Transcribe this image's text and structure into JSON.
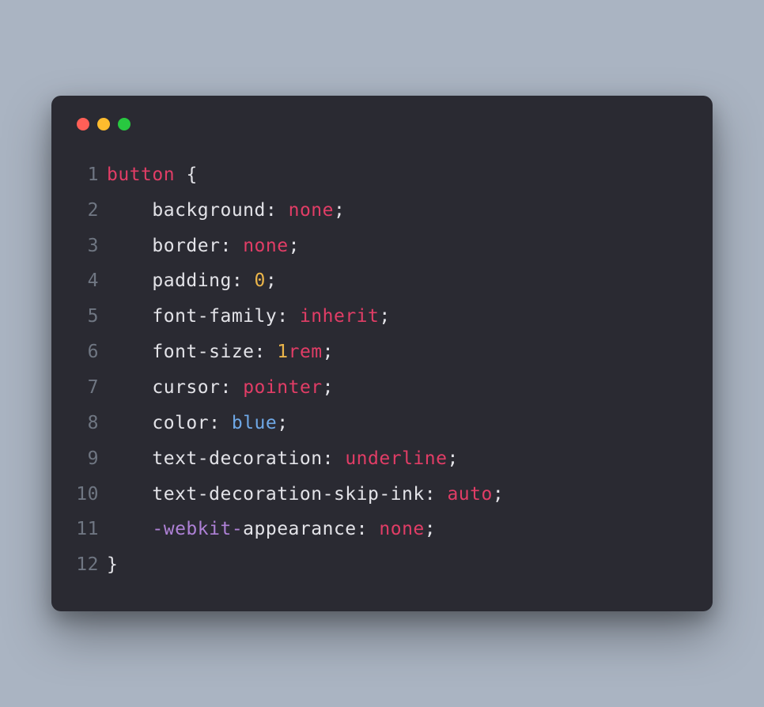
{
  "code": {
    "lines": [
      {
        "n": "1",
        "tokens": [
          {
            "t": "button",
            "c": "tok-selector"
          },
          {
            "t": " ",
            "c": "tok-default"
          },
          {
            "t": "{",
            "c": "tok-brace"
          }
        ]
      },
      {
        "n": "2",
        "tokens": [
          {
            "t": "    background",
            "c": "tok-default"
          },
          {
            "t": ":",
            "c": "tok-punct"
          },
          {
            "t": " ",
            "c": "tok-default"
          },
          {
            "t": "none",
            "c": "tok-value-keyword"
          },
          {
            "t": ";",
            "c": "tok-punct"
          }
        ]
      },
      {
        "n": "3",
        "tokens": [
          {
            "t": "    border",
            "c": "tok-default"
          },
          {
            "t": ":",
            "c": "tok-punct"
          },
          {
            "t": " ",
            "c": "tok-default"
          },
          {
            "t": "none",
            "c": "tok-value-keyword"
          },
          {
            "t": ";",
            "c": "tok-punct"
          }
        ]
      },
      {
        "n": "4",
        "tokens": [
          {
            "t": "    padding",
            "c": "tok-default"
          },
          {
            "t": ":",
            "c": "tok-punct"
          },
          {
            "t": " ",
            "c": "tok-default"
          },
          {
            "t": "0",
            "c": "tok-number"
          },
          {
            "t": ";",
            "c": "tok-punct"
          }
        ]
      },
      {
        "n": "5",
        "tokens": [
          {
            "t": "    font-family",
            "c": "tok-default"
          },
          {
            "t": ":",
            "c": "tok-punct"
          },
          {
            "t": " ",
            "c": "tok-default"
          },
          {
            "t": "inherit",
            "c": "tok-value-keyword"
          },
          {
            "t": ";",
            "c": "tok-punct"
          }
        ]
      },
      {
        "n": "6",
        "tokens": [
          {
            "t": "    font-size",
            "c": "tok-default"
          },
          {
            "t": ":",
            "c": "tok-punct"
          },
          {
            "t": " ",
            "c": "tok-default"
          },
          {
            "t": "1",
            "c": "tok-number"
          },
          {
            "t": "rem",
            "c": "tok-unit"
          },
          {
            "t": ";",
            "c": "tok-punct"
          }
        ]
      },
      {
        "n": "7",
        "tokens": [
          {
            "t": "    cursor",
            "c": "tok-default"
          },
          {
            "t": ":",
            "c": "tok-punct"
          },
          {
            "t": " ",
            "c": "tok-default"
          },
          {
            "t": "pointer",
            "c": "tok-value-keyword"
          },
          {
            "t": ";",
            "c": "tok-punct"
          }
        ]
      },
      {
        "n": "8",
        "tokens": [
          {
            "t": "    color",
            "c": "tok-default"
          },
          {
            "t": ":",
            "c": "tok-punct"
          },
          {
            "t": " ",
            "c": "tok-default"
          },
          {
            "t": "blue",
            "c": "tok-color"
          },
          {
            "t": ";",
            "c": "tok-punct"
          }
        ]
      },
      {
        "n": "9",
        "tokens": [
          {
            "t": "    text-decoration",
            "c": "tok-default"
          },
          {
            "t": ":",
            "c": "tok-punct"
          },
          {
            "t": " ",
            "c": "tok-default"
          },
          {
            "t": "underline",
            "c": "tok-value-keyword"
          },
          {
            "t": ";",
            "c": "tok-punct"
          }
        ]
      },
      {
        "n": "10",
        "tokens": [
          {
            "t": "    text-decoration-skip-ink",
            "c": "tok-default"
          },
          {
            "t": ":",
            "c": "tok-punct"
          },
          {
            "t": " ",
            "c": "tok-default"
          },
          {
            "t": "auto",
            "c": "tok-value-keyword"
          },
          {
            "t": ";",
            "c": "tok-punct"
          }
        ]
      },
      {
        "n": "11",
        "tokens": [
          {
            "t": "    ",
            "c": "tok-default"
          },
          {
            "t": "-webkit-",
            "c": "tok-vendor"
          },
          {
            "t": "appearance",
            "c": "tok-default"
          },
          {
            "t": ":",
            "c": "tok-punct"
          },
          {
            "t": " ",
            "c": "tok-default"
          },
          {
            "t": "none",
            "c": "tok-value-keyword"
          },
          {
            "t": ";",
            "c": "tok-punct"
          }
        ]
      },
      {
        "n": "12",
        "tokens": [
          {
            "t": "}",
            "c": "tok-brace"
          }
        ]
      }
    ]
  }
}
